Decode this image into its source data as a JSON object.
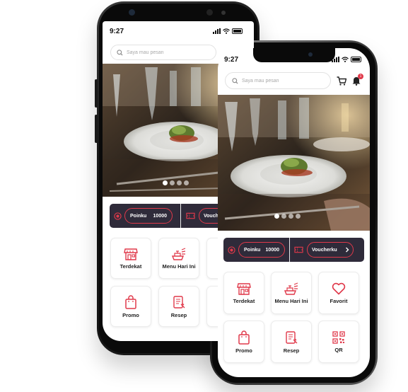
{
  "colors": {
    "accent": "#e0394a",
    "wallet_bg": "#2f2b3a",
    "screen_bg": "#ffffff"
  },
  "back_phone": {
    "status": {
      "time": "9:27"
    },
    "search": {
      "placeholder": "Saya mau pesan",
      "icon": "search-icon"
    },
    "carousel": {
      "slides": 4,
      "active_index": 0
    },
    "wallet": {
      "poin_label": "Poinku",
      "poin_value": "10000",
      "voucher_label": "Vouch"
    },
    "menu": [
      {
        "label": "Terdekat",
        "icon": "store-icon"
      },
      {
        "label": "Menu Hari Ini",
        "icon": "menu-today-icon"
      },
      {
        "label": "Promo",
        "icon": "shopping-bag-icon"
      },
      {
        "label": "Resep",
        "icon": "recipe-icon"
      }
    ]
  },
  "front_phone": {
    "status": {
      "time": "9:27"
    },
    "search": {
      "placeholder": "Saya mau pesan",
      "icon": "search-icon"
    },
    "header_icons": {
      "cart": "cart-icon",
      "bell": "bell-icon",
      "notification_count": "1"
    },
    "carousel": {
      "slides": 4,
      "active_index": 0
    },
    "wallet": {
      "poin_label": "Poinku",
      "poin_value": "10000",
      "voucher_label": "Voucherku"
    },
    "menu": [
      {
        "label": "Terdekat",
        "icon": "store-icon"
      },
      {
        "label": "Menu Hari Ini",
        "icon": "menu-today-icon"
      },
      {
        "label": "Favorit",
        "icon": "heart-icon"
      },
      {
        "label": "Promo",
        "icon": "shopping-bag-icon"
      },
      {
        "label": "Resep",
        "icon": "recipe-icon"
      },
      {
        "label": "QR",
        "icon": "qr-code-icon"
      }
    ]
  }
}
